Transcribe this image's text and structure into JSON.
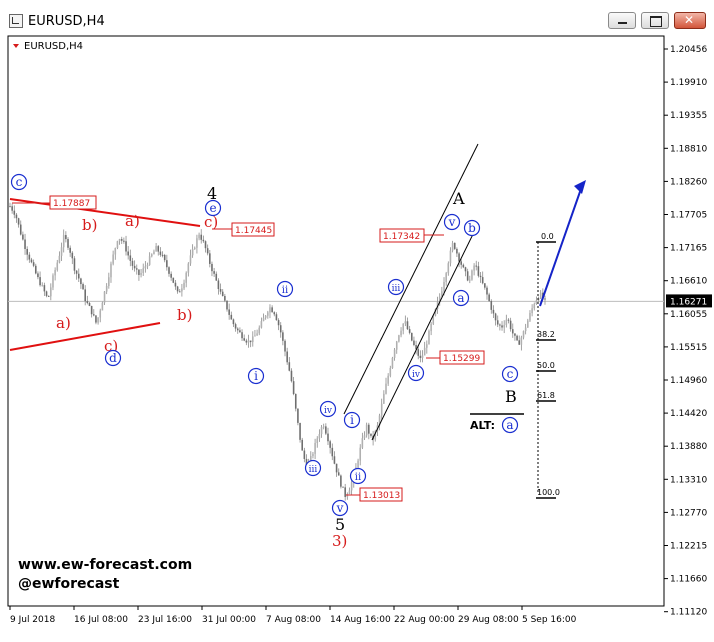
{
  "window": {
    "title": "EURUSD,H4"
  },
  "chart_data": {
    "type": "candlestick",
    "symbol_label": "EURUSD,H4",
    "current_price": "1.16271",
    "y_ticks": [
      "1.20456",
      "1.19910",
      "1.19355",
      "1.18810",
      "1.18260",
      "1.17705",
      "1.17165",
      "1.16610",
      "1.16055",
      "1.15515",
      "1.14960",
      "1.14420",
      "1.13880",
      "1.13310",
      "1.12770",
      "1.12215",
      "1.11660",
      "1.11120"
    ],
    "x_ticks": [
      "9 Jul 2018",
      "16 Jul 08:00",
      "23 Jul 16:00",
      "31 Jul 00:00",
      "7 Aug 08:00",
      "14 Aug 16:00",
      "22 Aug 00:00",
      "29 Aug 08:00",
      "5 Sep 16:00"
    ],
    "price_labels": [
      "1.17887",
      "1.17445",
      "1.17342",
      "1.15299",
      "1.13013"
    ],
    "fib_levels": [
      "0.0",
      "38.2",
      "50.0",
      "61.8",
      "100.0"
    ],
    "wave_labels_red": [
      "a)",
      "b)",
      "a)",
      "c)",
      "a)",
      "c)",
      "b)",
      "3)"
    ],
    "wave_labels_black": [
      "4",
      "A",
      "5",
      "B"
    ],
    "wave_labels_circled": [
      "c",
      "d",
      "e",
      "ii",
      "i",
      "iv",
      "iii",
      "i",
      "v",
      "ii",
      "iii",
      "iv",
      "v",
      "b",
      "a",
      "c",
      "a"
    ],
    "alt_label": "ALT:",
    "watermark": {
      "site": "www.ew-forecast.com",
      "handle": "@ewforecast"
    },
    "series": [
      {
        "points": [
          [
            0,
            1.1785
          ],
          [
            3,
            1.1772
          ],
          [
            6,
            1.174
          ],
          [
            9,
            1.1712
          ],
          [
            12,
            1.169
          ],
          [
            15,
            1.1668
          ],
          [
            18,
            1.165
          ],
          [
            21,
            1.163
          ],
          [
            24,
            1.1668
          ],
          [
            27,
            1.17
          ],
          [
            30,
            1.1735
          ],
          [
            33,
            1.1715
          ],
          [
            36,
            1.168
          ],
          [
            39,
            1.166
          ],
          [
            42,
            1.1628
          ],
          [
            45,
            1.1612
          ],
          [
            48,
            1.159
          ],
          [
            51,
            1.1625
          ],
          [
            54,
            1.166
          ],
          [
            57,
            1.17
          ],
          [
            60,
            1.1735
          ],
          [
            63,
            1.1725
          ],
          [
            66,
            1.17
          ],
          [
            69,
            1.168
          ],
          [
            72,
            1.167
          ],
          [
            75,
            1.1685
          ],
          [
            78,
            1.17
          ],
          [
            81,
            1.1715
          ],
          [
            84,
            1.1705
          ],
          [
            87,
            1.1685
          ],
          [
            90,
            1.1665
          ],
          [
            93,
            1.164
          ],
          [
            96,
            1.1655
          ],
          [
            99,
            1.169
          ],
          [
            102,
            1.1715
          ],
          [
            105,
            1.174
          ],
          [
            108,
            1.172
          ],
          [
            111,
            1.169
          ],
          [
            114,
            1.1665
          ],
          [
            117,
            1.164
          ],
          [
            120,
            1.162
          ],
          [
            123,
            1.1595
          ],
          [
            126,
            1.158
          ],
          [
            129,
            1.157
          ],
          [
            132,
            1.156
          ],
          [
            135,
            1.1565
          ],
          [
            138,
            1.158
          ],
          [
            141,
            1.16
          ],
          [
            144,
            1.1618
          ],
          [
            147,
            1.1608
          ],
          [
            150,
            1.158
          ],
          [
            153,
            1.154
          ],
          [
            156,
            1.15
          ],
          [
            159,
            1.144
          ],
          [
            162,
            1.138
          ],
          [
            165,
            1.135
          ],
          [
            168,
            1.1375
          ],
          [
            171,
            1.1405
          ],
          [
            174,
            1.1425
          ],
          [
            177,
            1.1395
          ],
          [
            180,
            1.136
          ],
          [
            183,
            1.133
          ],
          [
            186,
            1.1305
          ],
          [
            189,
            1.132
          ],
          [
            192,
            1.135
          ],
          [
            195,
            1.139
          ],
          [
            198,
            1.142
          ],
          [
            201,
            1.1395
          ],
          [
            204,
            1.142
          ],
          [
            207,
            1.1465
          ],
          [
            210,
            1.1505
          ],
          [
            213,
            1.1545
          ],
          [
            216,
            1.1575
          ],
          [
            219,
            1.1595
          ],
          [
            222,
            1.157
          ],
          [
            225,
            1.1548
          ],
          [
            228,
            1.153
          ],
          [
            231,
            1.1555
          ],
          [
            234,
            1.159
          ],
          [
            237,
            1.162
          ],
          [
            240,
            1.165
          ],
          [
            243,
            1.169
          ],
          [
            246,
            1.1725
          ],
          [
            249,
            1.17
          ],
          [
            252,
            1.1678
          ],
          [
            255,
            1.166
          ],
          [
            258,
            1.169
          ],
          [
            261,
            1.1665
          ],
          [
            264,
            1.1645
          ],
          [
            267,
            1.1618
          ],
          [
            270,
            1.159
          ],
          [
            273,
            1.1585
          ],
          [
            276,
            1.16
          ],
          [
            279,
            1.1575
          ],
          [
            282,
            1.1555
          ],
          [
            285,
            1.1575
          ],
          [
            288,
            1.16
          ],
          [
            291,
            1.1625
          ],
          [
            294,
            1.164
          ],
          [
            297,
            1.1627
          ]
        ]
      }
    ]
  }
}
